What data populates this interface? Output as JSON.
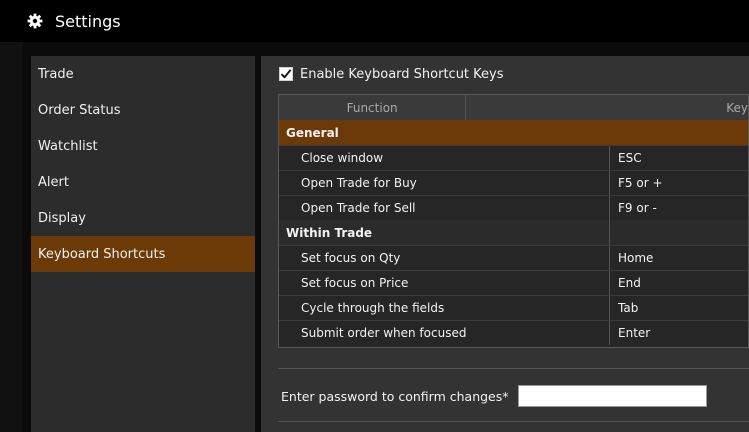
{
  "window": {
    "title": "Settings",
    "icon": "gear-icon"
  },
  "sidebar": {
    "items": [
      {
        "label": "Trade"
      },
      {
        "label": "Order Status"
      },
      {
        "label": "Watchlist"
      },
      {
        "label": "Alert"
      },
      {
        "label": "Display"
      },
      {
        "label": "Keyboard Shortcuts",
        "active": true
      }
    ]
  },
  "main": {
    "enable_checkbox": {
      "label": "Enable Keyboard Shortcut Keys",
      "checked": true
    },
    "table": {
      "headers": {
        "function": "Function",
        "key": "Key"
      },
      "rows": [
        {
          "function": "General",
          "key": ""
        },
        {
          "function": "Close window",
          "key": "ESC"
        },
        {
          "function": "Open Trade for Buy",
          "key": "F5 or +"
        },
        {
          "function": "Open Trade for Sell",
          "key": "F9 or -"
        },
        {
          "function": "Within Trade",
          "key": ""
        },
        {
          "function": "Set focus on Qty",
          "key": "Home"
        },
        {
          "function": "Set focus on Price",
          "key": "End"
        },
        {
          "function": "Cycle through the fields",
          "key": "Tab"
        },
        {
          "function": "Submit order when focused",
          "key": "Enter"
        }
      ]
    },
    "password": {
      "label": "Enter password to confirm changes*",
      "value": "",
      "placeholder": ""
    }
  },
  "colors": {
    "accent": "#6c3a06",
    "panel": "#2c2c2c",
    "content": "#333333",
    "titlebar": "#000000"
  }
}
